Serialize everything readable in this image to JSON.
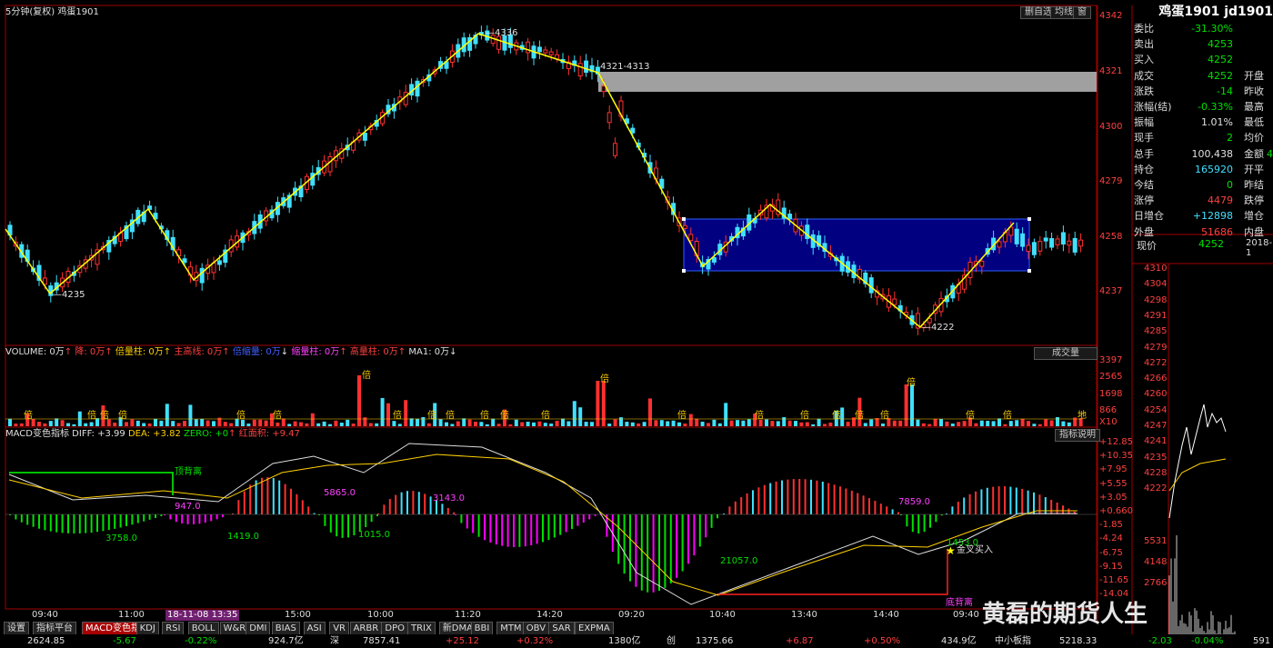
{
  "top_right_buttons": [
    "删自选",
    "均线",
    "窗"
  ],
  "chart_header": {
    "period": "5分钟(复权)",
    "name": "鸡蛋1901"
  },
  "price_scale": [
    "4342",
    "4321",
    "4300",
    "4279",
    "4258",
    "4237"
  ],
  "price_annotations": {
    "high": "4336",
    "low1": "4235",
    "low2": "4222",
    "gap": "4321-4313"
  },
  "volume_legend": {
    "vol": "VOLUME: 0万",
    "down": "降: 0万",
    "double": "倍量柱: 0万",
    "main_up": "主高线: 0万",
    "abnormal": "倍缩量: 0万",
    "gap_down": "缩量柱: 0万",
    "high_vol": "高量柱: 0万",
    "ma": "MA1: 0万"
  },
  "volume_button": "成交量",
  "volume_scale": [
    "3397",
    "2565",
    "1698",
    "866",
    "X10"
  ],
  "volume_marks": [
    "倍",
    "倍",
    "倍",
    "倍",
    "倍",
    "倍",
    "倍",
    "倍",
    "倍",
    "倍",
    "倍",
    "倍",
    "倍",
    "倍",
    "倍",
    "倍",
    "倍",
    "倍",
    "倍",
    "倍",
    "倍",
    "倍",
    "倍",
    "地"
  ],
  "macd_legend": {
    "name": "MACD变色指标",
    "diff": "DIFF: +3.99",
    "dea": "DEA: +3.82",
    "zero": "ZERO: +0",
    "red": "红面积: +9.47"
  },
  "macd_button": "指标说明",
  "macd_scale": [
    "+12.85",
    "+10.35",
    "+7.95",
    "+5.55",
    "+3.05",
    "+0.660",
    "-1.85",
    "-4.24",
    "-6.75",
    "-9.15",
    "-11.65",
    "-14.04"
  ],
  "macd_annotations": {
    "top_div": "顶背离",
    "a1": "947.0",
    "a2": "5865.0",
    "a3": "3143.0",
    "a4": "7859.0",
    "b1": "3758.0",
    "b2": "1419.0",
    "b3": "1015.0",
    "b4": "21057.0",
    "b5": "1453.0",
    "golden": "金叉买入",
    "bottom_div": "底背离"
  },
  "time_axis": [
    "09:40",
    "11:00",
    "18-11-08 13:35",
    "15:00",
    "10:00",
    "11:20",
    "14:20",
    "09:20",
    "10:40",
    "13:40",
    "14:40",
    "09:40"
  ],
  "tabs": [
    "设置",
    "指标平台",
    "MACD变色指标",
    "KDJ",
    "RSI",
    "BOLL",
    "W&R",
    "DMI",
    "BIAS",
    "ASI",
    "VR",
    "ARBR",
    "DPO",
    "TRIX",
    "新DMA",
    "BBI",
    "MTM",
    "OBV",
    "SAR",
    "EXPMA"
  ],
  "active_tab": "MACD变色指标",
  "quote": {
    "title": "鸡蛋1901 jd1901",
    "rows": [
      {
        "l": "委比",
        "v": "-31.30%",
        "vc": "green",
        "l2": "",
        "v2": ""
      },
      {
        "l": "卖出",
        "v": "4253",
        "vc": "green",
        "l2": "",
        "v2": ""
      },
      {
        "l": "买入",
        "v": "4252",
        "vc": "green",
        "l2": "",
        "v2": ""
      },
      {
        "l": "成交",
        "v": "4252",
        "vc": "green",
        "l2": "开盘",
        "v2": ""
      },
      {
        "l": "涨跌",
        "v": "-14",
        "vc": "green",
        "l2": "昨收",
        "v2": ""
      },
      {
        "l": "涨幅(结)",
        "v": "-0.33%",
        "vc": "green",
        "l2": "最高",
        "v2": ""
      },
      {
        "l": "振幅",
        "v": "1.01%",
        "vc": "white",
        "l2": "最低",
        "v2": ""
      },
      {
        "l": "现手",
        "v": "2",
        "vc": "green",
        "l2": "均价",
        "v2": ""
      },
      {
        "l": "总手",
        "v": "100,438",
        "vc": "white",
        "l2": "金额",
        "v2": "4"
      },
      {
        "l": "持仓",
        "v": "165920",
        "vc": "cyan",
        "l2": "开平",
        "v2": ""
      },
      {
        "l": "今结",
        "v": "0",
        "vc": "green",
        "l2": "昨结",
        "v2": ""
      },
      {
        "l": "涨停",
        "v": "4479",
        "vc": "red",
        "l2": "跌停",
        "v2": ""
      },
      {
        "l": "日增仓",
        "v": "+12898",
        "vc": "cyan",
        "l2": "增仓",
        "v2": ""
      },
      {
        "l": "外盘",
        "v": "51686",
        "vc": "red",
        "l2": "内盘",
        "v2": ""
      }
    ],
    "now_label": "现价",
    "now_value": "4252",
    "now_date": "2018-1"
  },
  "mini_scale": [
    "4310",
    "4304",
    "4298",
    "4291",
    "4285",
    "4279",
    "4272",
    "4266",
    "4260",
    "4254",
    "4247",
    "4241",
    "4235",
    "4228",
    "4222",
    "5531",
    "4148",
    "2766"
  ],
  "status_bar": [
    {
      "t": "2624.85",
      "c": "white"
    },
    {
      "t": "-5.67",
      "c": "green"
    },
    {
      "t": "-0.22%",
      "c": "green"
    },
    {
      "t": "924.7亿",
      "c": "white"
    },
    {
      "t": "深",
      "c": "white"
    },
    {
      "t": "7857.41",
      "c": "white"
    },
    {
      "t": "+25.12",
      "c": "red"
    },
    {
      "t": "+0.32%",
      "c": "red"
    },
    {
      "t": "1380亿",
      "c": "white"
    },
    {
      "t": "创",
      "c": "white"
    },
    {
      "t": "1375.66",
      "c": "white"
    },
    {
      "t": "+6.87",
      "c": "red"
    },
    {
      "t": "+0.50%",
      "c": "red"
    },
    {
      "t": "434.9亿",
      "c": "white"
    },
    {
      "t": "中小板指",
      "c": "white"
    },
    {
      "t": "5218.33",
      "c": "white"
    },
    {
      "t": "-2.03",
      "c": "green"
    },
    {
      "t": "-0.04%",
      "c": "green"
    },
    {
      "t": "591",
      "c": "white"
    }
  ],
  "watermark": "黄磊的期货人生",
  "colors": {
    "up": "#ff3030",
    "down": "#40e0ff",
    "zigzag": "#ffff00",
    "box": "#000080",
    "gap": "#a0a0a0",
    "macd_up": "#ff3030",
    "macd_down_green": "#00e000",
    "macd_down_magenta": "#ff00ff"
  }
}
